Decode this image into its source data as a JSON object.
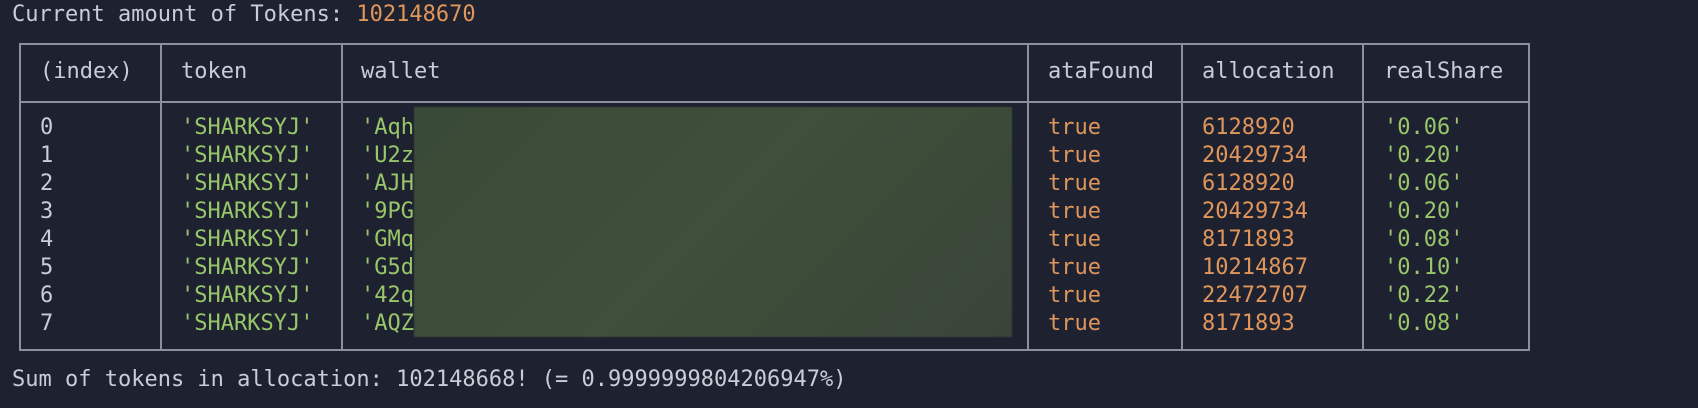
{
  "header": {
    "label": "Current amount of Tokens: ",
    "value": "102148670"
  },
  "table": {
    "columns": [
      "(index)",
      "token",
      "wallet",
      "ataFound",
      "allocation",
      "realShare"
    ],
    "rows": [
      {
        "index": "0",
        "token": "'SHARKSYJ'",
        "wallet": "'Aqh",
        "ataFound": "true",
        "allocation": "6128920",
        "realShare": "'0.06'"
      },
      {
        "index": "1",
        "token": "'SHARKSYJ'",
        "wallet": "'U2z",
        "ataFound": "true",
        "allocation": "20429734",
        "realShare": "'0.20'"
      },
      {
        "index": "2",
        "token": "'SHARKSYJ'",
        "wallet": "'AJH",
        "ataFound": "true",
        "allocation": "6128920",
        "realShare": "'0.06'"
      },
      {
        "index": "3",
        "token": "'SHARKSYJ'",
        "wallet": "'9PG",
        "ataFound": "true",
        "allocation": "20429734",
        "realShare": "'0.20'"
      },
      {
        "index": "4",
        "token": "'SHARKSYJ'",
        "wallet": "'GMq",
        "ataFound": "true",
        "allocation": "8171893",
        "realShare": "'0.08'"
      },
      {
        "index": "5",
        "token": "'SHARKSYJ'",
        "wallet": "'G5d",
        "ataFound": "true",
        "allocation": "10214867",
        "realShare": "'0.10'"
      },
      {
        "index": "6",
        "token": "'SHARKSYJ'",
        "wallet": "'42q",
        "ataFound": "true",
        "allocation": "22472707",
        "realShare": "'0.22'"
      },
      {
        "index": "7",
        "token": "'SHARKSYJ'",
        "wallet": "'AQZ",
        "ataFound": "true",
        "allocation": "8171893",
        "realShare": "'0.08'"
      }
    ]
  },
  "footer": {
    "text": "Sum of tokens in allocation: 102148668! (= 0.9999999804206947%)"
  },
  "colors": {
    "background": "#1e2230",
    "text": "#c8cdd6",
    "number": "#e0955a",
    "string": "#98c66a",
    "border": "#8a909c"
  }
}
